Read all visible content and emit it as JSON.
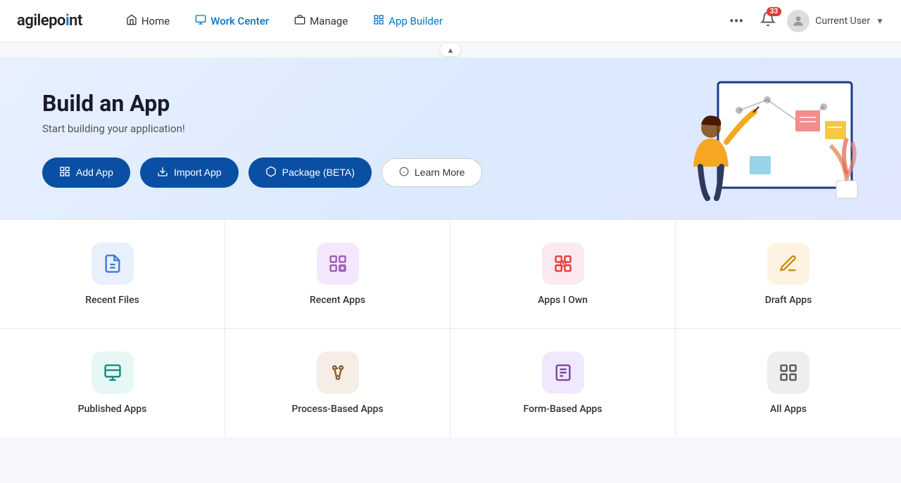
{
  "logo": {
    "text_before_dot": "agilepo",
    "text_after_dot": "nt"
  },
  "nav": {
    "items": [
      {
        "id": "home",
        "label": "Home",
        "icon": "home"
      },
      {
        "id": "workcenter",
        "label": "Work Center",
        "icon": "monitor"
      },
      {
        "id": "manage",
        "label": "Manage",
        "icon": "briefcase"
      },
      {
        "id": "appbuilder",
        "label": "App Builder",
        "icon": "grid"
      }
    ],
    "more_label": "•••",
    "notification_count": "33",
    "username": "Current User"
  },
  "hero": {
    "title": "Build an App",
    "subtitle": "Start building your application!",
    "buttons": [
      {
        "id": "add-app",
        "label": "Add App",
        "type": "primary"
      },
      {
        "id": "import-app",
        "label": "Import App",
        "type": "primary"
      },
      {
        "id": "package-beta",
        "label": "Package (BETA)",
        "type": "primary"
      },
      {
        "id": "learn-more",
        "label": "Learn More",
        "type": "outline"
      }
    ]
  },
  "cards_row1": [
    {
      "id": "recent-files",
      "label": "Recent Files",
      "icon_color": "blue"
    },
    {
      "id": "recent-apps",
      "label": "Recent Apps",
      "icon_color": "purple"
    },
    {
      "id": "apps-i-own",
      "label": "Apps I Own",
      "icon_color": "pink"
    },
    {
      "id": "draft-apps",
      "label": "Draft Apps",
      "icon_color": "gold"
    }
  ],
  "cards_row2": [
    {
      "id": "published-apps",
      "label": "Published Apps",
      "icon_color": "teal"
    },
    {
      "id": "process-based-apps",
      "label": "Process-Based Apps",
      "icon_color": "brown"
    },
    {
      "id": "form-based-apps",
      "label": "Form-Based Apps",
      "icon_color": "violet"
    },
    {
      "id": "all-apps",
      "label": "All Apps",
      "icon_color": "gray"
    }
  ]
}
